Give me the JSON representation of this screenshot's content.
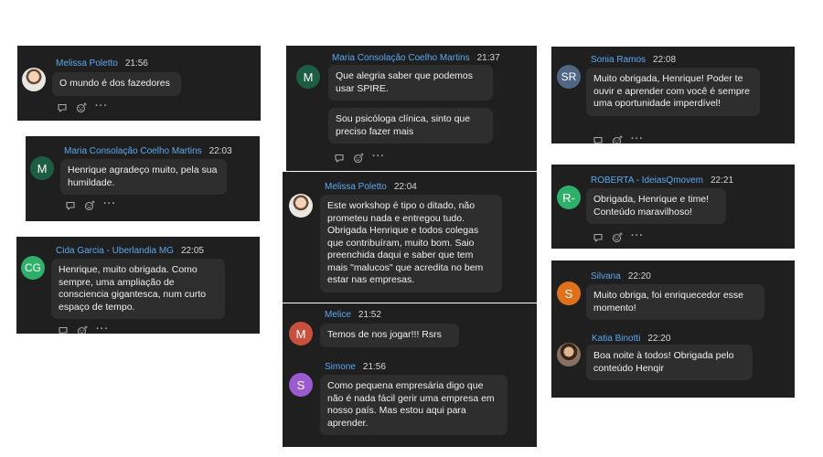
{
  "actions": {
    "more": "···"
  },
  "c1": {
    "name": "Melissa Poletto",
    "time": "21:56",
    "text": "O mundo é dos fazedores"
  },
  "c2": {
    "avatar": "M",
    "name": "Maria Consolação Coelho Martins",
    "time": "22:03",
    "text": "Henrique agradeço muito, pela sua humildade."
  },
  "c3": {
    "avatar": "CG",
    "name": "Cida Garcia - Uberlandia MG",
    "time": "22:05",
    "text": "Henrique, muito obrigada. Como sempre, uma ampliação de consciencia gigantesca, num curto espaço de tempo."
  },
  "c4": {
    "avatar": "M",
    "name": "Maria Consolação Coelho Martins",
    "time": "21:37",
    "text1": "Que alegria saber que podemos usar SPIRE.",
    "text2": "Sou psicóloga clínica, sinto que preciso fazer mais"
  },
  "c5": {
    "name": "Melissa Poletto",
    "time": "22:04",
    "text": "Este workshop é tipo o ditado, não prometeu nada e entregou tudo. Obrigada Henrique e todos colegas que contribuíram, muito bom. Saio preenchida daqui e saber que tem mais \"malucos\" que acredita no bem estar nas empresas."
  },
  "c6": {
    "m1_avatar": "M",
    "m1_name": "Melice",
    "m1_time": "21:52",
    "m1_text": "Temos de nos jogar!!! Rsrs",
    "m2_avatar": "S",
    "m2_name": "Simone",
    "m2_time": "21:56",
    "m2_text": "Como pequena empresária digo que não é nada fácil gerir uma empresa em nosso país. Mas estou aqui para aprender."
  },
  "c7": {
    "avatar": "SR",
    "name": "Sonia Ramos",
    "time": "22:08",
    "text": "Muito obrigada, Henrique! Poder te ouvir e aprender com você é sempre uma oportunidade imperdível!"
  },
  "c8": {
    "avatar": "R-",
    "name": "ROBERTA - IdeiasQmovem",
    "time": "22:21",
    "text": "Obrigada, Henrique e time! Conteúdo maravilhoso!"
  },
  "c9": {
    "m1_avatar": "S",
    "m1_name": "Silvana",
    "m1_time": "22:20",
    "m1_text": "Muito obriga, foi enriquecedor esse momento!",
    "m2_name": "Katia Binotti",
    "m2_time": "22:20",
    "m2_text": "Boa noite à todos! Obrigada pelo conteúdo Henqir"
  },
  "colors": {
    "card_bg": "#1f1f1f",
    "bubble_bg": "#2e2e2e",
    "name": "#5aa9f0",
    "avatar_green_dark": "#1d5c45",
    "avatar_green": "#2fb06a",
    "avatar_slate": "#4f6785",
    "avatar_red": "#c9503e",
    "avatar_purple": "#9a5ad0",
    "avatar_orange": "#e0711c"
  }
}
